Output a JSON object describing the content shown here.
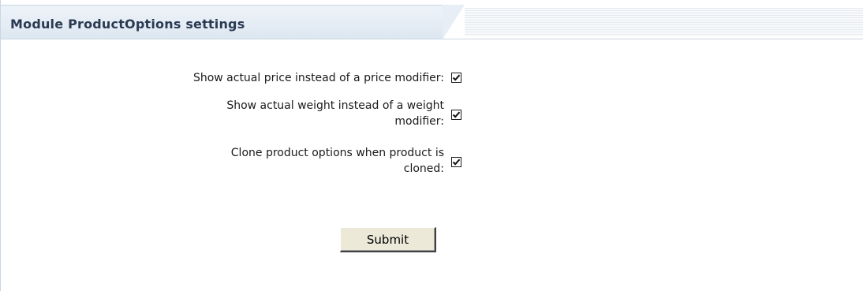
{
  "panel": {
    "title": "Module ProductOptions settings"
  },
  "settings": [
    {
      "label_lines": [
        "Show actual price instead of a price modifier:"
      ],
      "checked": true
    },
    {
      "label_lines": [
        "Show actual weight instead of a weight",
        "modifier:"
      ],
      "checked": true
    },
    {
      "label_lines": [
        "Clone product options when product is",
        "cloned:"
      ],
      "checked": true
    }
  ],
  "form": {
    "submit_label": "Submit"
  }
}
